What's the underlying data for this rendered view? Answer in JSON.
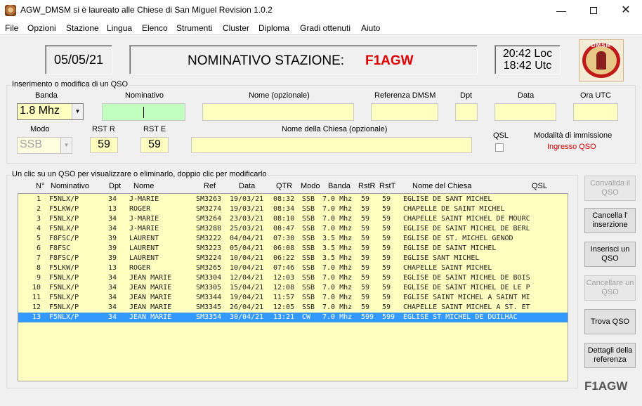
{
  "window": {
    "title": "AGW_DMSM si è laureato alle Chiese di San Miguel   Revision  1.0.2",
    "minimize_glyph": "—",
    "close_glyph": "✕"
  },
  "menu": [
    "File",
    "Opzioni",
    "Stazione",
    "Lingua",
    "Elenco",
    "Strumenti",
    "Cluster",
    "Diploma",
    "Gradi ottenuti",
    "Aiuto"
  ],
  "header": {
    "date": "05/05/21",
    "station_label": "NOMINATIVO STAZIONE:",
    "callsign": "F1AGW",
    "time_loc": "20:42 Loc",
    "time_utc": "18:42 Utc",
    "logo_text": "DMSM"
  },
  "form": {
    "legend": "Inserimento o modifica di un QSO",
    "labels": {
      "banda": "Banda",
      "nominativo": "Nominativo",
      "nome": "Nome (opzionale)",
      "referenza": "Referenza DMSM",
      "dpt": "Dpt",
      "data": "Data",
      "ora": "Ora UTC",
      "modo": "Modo",
      "rst_r": "RST R",
      "rst_e": "RST E",
      "chiesa": "Nome della Chiesa (opzionale)",
      "qsl": "QSL",
      "modalita": "Modalità di immissione"
    },
    "banda_value": "1.8 Mhz",
    "modo_value": "SSB",
    "rst_r_value": "59",
    "rst_e_value": "59",
    "modalita_value": "Ingresso QSO"
  },
  "list": {
    "legend": "Un clic su un QSO per visualizzare o eliminarlo, doppio clic per modificarlo",
    "headers": [
      "N°",
      "Nominativo",
      "Dpt",
      "Nome",
      "Ref",
      "Data",
      "QTR",
      "Modo",
      "Banda",
      "RstR",
      "RstT",
      "Nome del Chiesa",
      "QSL"
    ],
    "rows": [
      {
        "n": "1",
        "call": "F5NLX/P",
        "dpt": "34",
        "nome": "J-MARIE",
        "ref": "SM3263",
        "data": "19/03/21",
        "qtr": "08:32",
        "modo": "SSB",
        "banda": "7.0 Mhz",
        "rstr": "59",
        "rstt": "59",
        "chiesa": "EGLISE DE SANT MICHEL"
      },
      {
        "n": "2",
        "call": "F5LKW/P",
        "dpt": "13",
        "nome": "ROGER",
        "ref": "SM3274",
        "data": "19/03/21",
        "qtr": "08:34",
        "modo": "SSB",
        "banda": "7.0 Mhz",
        "rstr": "59",
        "rstt": "59",
        "chiesa": "CHAPELLE DE SAINT MICHEL"
      },
      {
        "n": "3",
        "call": "F5NLX/P",
        "dpt": "34",
        "nome": "J-MARIE",
        "ref": "SM3264",
        "data": "23/03/21",
        "qtr": "08:10",
        "modo": "SSB",
        "banda": "7.0 Mhz",
        "rstr": "59",
        "rstt": "59",
        "chiesa": "CHAPELLE SAINT MICHEL DE MOURC"
      },
      {
        "n": "4",
        "call": "F5NLX/P",
        "dpt": "34",
        "nome": "J-MARIE",
        "ref": "SM3288",
        "data": "25/03/21",
        "qtr": "08:47",
        "modo": "SSB",
        "banda": "7.0 Mhz",
        "rstr": "59",
        "rstt": "59",
        "chiesa": "EGLISE DE SAINT MICHEL DE BERL"
      },
      {
        "n": "5",
        "call": "F8FSC/P",
        "dpt": "39",
        "nome": "LAURENT",
        "ref": "SM3222",
        "data": "04/04/21",
        "qtr": "07:30",
        "modo": "SSB",
        "banda": "3.5 Mhz",
        "rstr": "59",
        "rstt": "59",
        "chiesa": "EGLISE DE ST. MICHEL GENOD"
      },
      {
        "n": "6",
        "call": "F8FSC",
        "dpt": "39",
        "nome": "LAURENT",
        "ref": "SM3223",
        "data": "05/04/21",
        "qtr": "06:08",
        "modo": "SSB",
        "banda": "3.5 Mhz",
        "rstr": "59",
        "rstt": "59",
        "chiesa": "EGLISE DE SAINT MICHEL"
      },
      {
        "n": "7",
        "call": "F8FSC/P",
        "dpt": "39",
        "nome": "LAURENT",
        "ref": "SM3224",
        "data": "10/04/21",
        "qtr": "06:22",
        "modo": "SSB",
        "banda": "3.5 Mhz",
        "rstr": "59",
        "rstt": "59",
        "chiesa": "EGLISE SANT MICHEL"
      },
      {
        "n": "8",
        "call": "F5LKW/P",
        "dpt": "13",
        "nome": "ROGER",
        "ref": "SM3265",
        "data": "10/04/21",
        "qtr": "07:46",
        "modo": "SSB",
        "banda": "7.0 Mhz",
        "rstr": "59",
        "rstt": "59",
        "chiesa": "CHAPELLE SAINT MICHEL"
      },
      {
        "n": "9",
        "call": "F5NLX/P",
        "dpt": "34",
        "nome": "JEAN MARIE",
        "ref": "SM3304",
        "data": "12/04/21",
        "qtr": "12:03",
        "modo": "SSB",
        "banda": "7.0 Mhz",
        "rstr": "59",
        "rstt": "59",
        "chiesa": "EGLISE DE SAINT MICHEL DE BOIS"
      },
      {
        "n": "10",
        "call": "F5NLX/P",
        "dpt": "34",
        "nome": "JEAN MARIE",
        "ref": "SM3305",
        "data": "15/04/21",
        "qtr": "12:08",
        "modo": "SSB",
        "banda": "7.0 Mhz",
        "rstr": "59",
        "rstt": "59",
        "chiesa": "EGLISE DE SAINT MICHEL DE LE P"
      },
      {
        "n": "11",
        "call": "F5NLX/P",
        "dpt": "34",
        "nome": "JEAN MARIE",
        "ref": "SM3344",
        "data": "19/04/21",
        "qtr": "11:57",
        "modo": "SSB",
        "banda": "7.0 Mhz",
        "rstr": "59",
        "rstt": "59",
        "chiesa": "EGLISE SAINT MICHEL A SAINT MI"
      },
      {
        "n": "12",
        "call": "F5NLX/P",
        "dpt": "34",
        "nome": "JEAN MARIE",
        "ref": "SM3345",
        "data": "26/04/21",
        "qtr": "12:05",
        "modo": "SSB",
        "banda": "7.0 Mhz",
        "rstr": "59",
        "rstt": "59",
        "chiesa": "CHAPELLE SAINT MICHEL A ST. ET"
      },
      {
        "n": "13",
        "call": "F5NLX/P",
        "dpt": "34",
        "nome": "JEAN MARIE",
        "ref": "SM3354",
        "data": "30/04/21",
        "qtr": "13:21",
        "modo": "CW",
        "banda": "7.0 Mhz",
        "rstr": "599",
        "rstt": "599",
        "chiesa": "EGLISE ST MICHEL DE DUILHAC",
        "selected": true
      }
    ]
  },
  "buttons": {
    "convalida": "Convalida il QSO",
    "cancella_ins": "Cancella l' inserzione",
    "inserisci": "Inserisci un QSO",
    "cancellare": "Cancellare un QSO",
    "trova": "Trova QSO",
    "dettagli": "Dettagli della referenza"
  },
  "brand": "F1AGW"
}
